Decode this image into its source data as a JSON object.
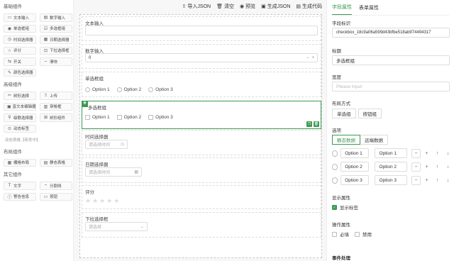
{
  "left": {
    "groups": [
      {
        "title": "基础组件",
        "items": [
          {
            "icon": "▭",
            "label": "文本输入"
          },
          {
            "icon": "▤",
            "label": "数字输入"
          },
          {
            "icon": "◉",
            "label": "单选框组"
          },
          {
            "icon": "☑",
            "label": "多选框组"
          },
          {
            "icon": "◷",
            "label": "时间选择器"
          },
          {
            "icon": "▦",
            "label": "日期选择器"
          },
          {
            "icon": "☆",
            "label": "评分"
          },
          {
            "icon": "⊡",
            "label": "下拉选择框"
          },
          {
            "icon": "⇆",
            "label": "开关"
          },
          {
            "icon": "⇔",
            "label": "滑块"
          },
          {
            "icon": "✎",
            "label": "颜色选择器"
          }
        ]
      },
      {
        "title": "高级组件",
        "items": [
          {
            "icon": "✂",
            "label": "树形选择"
          },
          {
            "icon": "⇪",
            "label": "上传"
          },
          {
            "icon": "▣",
            "label": "富文本编辑器"
          },
          {
            "icon": "▥",
            "label": "穿梭框"
          },
          {
            "icon": "⚲",
            "label": "级联选择器"
          },
          {
            "icon": "⊞",
            "label": "树形组件"
          },
          {
            "icon": "⊙",
            "label": "动态标签"
          }
        ],
        "extra": "动态表格【研发中】"
      },
      {
        "title": "布局组件",
        "items": [
          {
            "icon": "▦",
            "label": "栅格布局"
          },
          {
            "icon": "▤",
            "label": "静态表格"
          }
        ]
      },
      {
        "title": "其它组件",
        "items": [
          {
            "icon": "T",
            "label": "文字"
          },
          {
            "icon": "⎯",
            "label": "分割线"
          },
          {
            "icon": "ⓘ",
            "label": "警告信息"
          },
          {
            "icon": "▭",
            "label": "按钮"
          }
        ]
      }
    ]
  },
  "toolbar": {
    "import": "导入JSON",
    "clear": "清空",
    "preview": "预览",
    "gen_json": "生成JSON",
    "gen_code": "生成代码"
  },
  "canvas": {
    "text_input": {
      "label": "文本输入"
    },
    "number_input": {
      "label": "数字输入",
      "value": "0",
      "minus": "−",
      "plus": "+"
    },
    "radio": {
      "label": "单选框组",
      "options": [
        "Option 1",
        "Option 2",
        "Option 3"
      ]
    },
    "checkbox": {
      "label": "多选框组",
      "options": [
        "Option 1",
        "Option 2",
        "Option 3"
      ]
    },
    "time": {
      "label": "时间选择器",
      "placeholder": "请选择时间"
    },
    "date": {
      "label": "日期选择器",
      "placeholder": "请选择时间"
    },
    "rate": {
      "label": "评分"
    },
    "select": {
      "label": "下拉选择框",
      "placeholder": "请选择"
    }
  },
  "right": {
    "tabs": [
      "字段属性",
      "表单属性"
    ],
    "field_id_label": "字段标识",
    "field_id_value": "checkbox_18c9a06a599d43bfbe518ab974494317",
    "title_label": "标题",
    "title_value": "多选框组",
    "width_label": "宽度",
    "width_placeholder": "Please Input",
    "layout_label": "布局方式",
    "layout_options": [
      "单选组",
      "按钮组"
    ],
    "options_label": "选项",
    "options_source": [
      "静态数据",
      "远端数据"
    ],
    "options": [
      {
        "label": "Option 1",
        "value": "Option 1"
      },
      {
        "label": "Option 2",
        "value": "Option 2"
      },
      {
        "label": "Option 3",
        "value": "Option 3"
      }
    ],
    "display_label": "显示属性",
    "show_label": "显示标签",
    "action_label": "操作属性",
    "required": "必填",
    "disabled": "禁用",
    "event_label": "事件处理"
  },
  "colors": {
    "accent": "#3c9a52"
  }
}
